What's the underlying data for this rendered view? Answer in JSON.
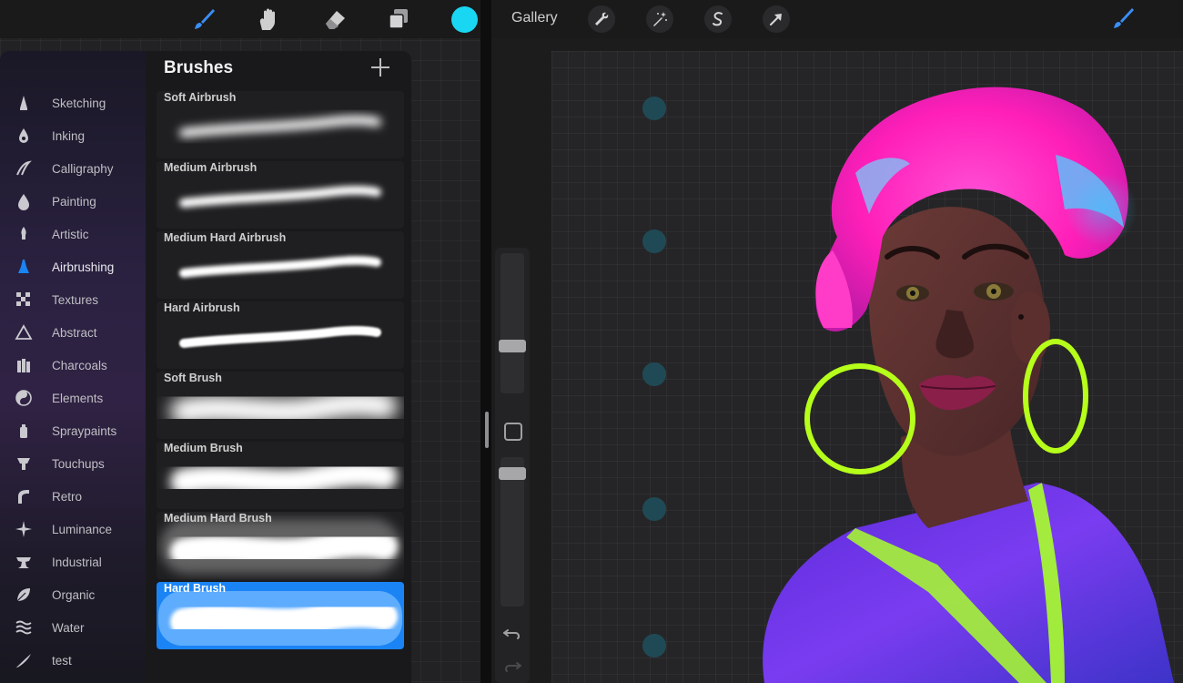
{
  "left_toolbar": {
    "tools": [
      {
        "name": "brush-tool",
        "icon": "brush-icon",
        "color": "#3a8ef6"
      },
      {
        "name": "smudge-tool",
        "icon": "smudge-icon",
        "color": "#cfcfcf"
      },
      {
        "name": "eraser-tool",
        "icon": "eraser-icon",
        "color": "#cfcfcf"
      },
      {
        "name": "layers-tool",
        "icon": "layers-icon",
        "color": "#cfcfcf"
      }
    ],
    "color_swatch": "#19d6f2"
  },
  "brush_panel": {
    "title": "Brushes",
    "add_label": "+",
    "categories": [
      {
        "label": "Sketching",
        "icon": "pencil-tip-icon"
      },
      {
        "label": "Inking",
        "icon": "ink-drop-icon"
      },
      {
        "label": "Calligraphy",
        "icon": "calligraphy-icon"
      },
      {
        "label": "Painting",
        "icon": "paint-drop-icon"
      },
      {
        "label": "Artistic",
        "icon": "flame-brush-icon"
      },
      {
        "label": "Airbrushing",
        "icon": "airbrush-icon",
        "active": true
      },
      {
        "label": "Textures",
        "icon": "checker-icon"
      },
      {
        "label": "Abstract",
        "icon": "triangle-icon"
      },
      {
        "label": "Charcoals",
        "icon": "charcoal-icon"
      },
      {
        "label": "Elements",
        "icon": "yin-yang-icon"
      },
      {
        "label": "Spraypaints",
        "icon": "spray-can-icon"
      },
      {
        "label": "Touchups",
        "icon": "touchup-icon"
      },
      {
        "label": "Retro",
        "icon": "retro-icon"
      },
      {
        "label": "Luminance",
        "icon": "sparkle-icon"
      },
      {
        "label": "Industrial",
        "icon": "anvil-icon"
      },
      {
        "label": "Organic",
        "icon": "leaf-icon"
      },
      {
        "label": "Water",
        "icon": "waves-icon"
      },
      {
        "label": "test",
        "icon": "feather-stroke-icon"
      }
    ],
    "brushes": [
      {
        "label": "Soft Airbrush",
        "style": "soft-thin"
      },
      {
        "label": "Medium Airbrush",
        "style": "medium-thin"
      },
      {
        "label": "Medium Hard Airbrush",
        "style": "mediumhard-thin"
      },
      {
        "label": "Hard Airbrush",
        "style": "hard-thin"
      },
      {
        "label": "Soft Brush",
        "style": "soft-wide"
      },
      {
        "label": "Medium Brush",
        "style": "medium-wide"
      },
      {
        "label": "Medium Hard Brush",
        "style": "mediumhard-wide"
      },
      {
        "label": "Hard Brush",
        "style": "hard-wide",
        "selected": true
      }
    ],
    "accent_color": "#1a84f5"
  },
  "right_toolbar": {
    "gallery_label": "Gallery",
    "actions": [
      {
        "name": "wrench-icon"
      },
      {
        "name": "magic-wand-icon"
      },
      {
        "name": "selection-s-icon"
      },
      {
        "name": "transform-arrow-icon"
      }
    ],
    "brush_icon": "brush-icon"
  },
  "canvas": {
    "background": "#252527",
    "dot_color": "#1f4a55",
    "artwork": "neon-portrait-illustration"
  }
}
